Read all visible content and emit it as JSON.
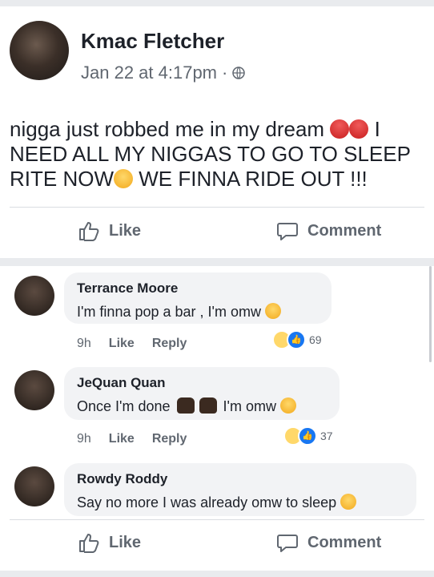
{
  "post": {
    "author": "Kmac Fletcher",
    "timestamp": "Jan 22 at 4:17pm",
    "separator": "·",
    "body_line1": "nigga just robbed me in my dream",
    "body_line1_end": "I",
    "body_line2": "NEED ALL MY NIGGAS TO GO TO SLEEP",
    "body_line3a": "RITE NOW",
    "body_line3b": "WE FINNA RIDE OUT !!!",
    "like_label": "Like",
    "comment_label": "Comment"
  },
  "comments": [
    {
      "name": "Terrance Moore",
      "text": "I'm finna pop a bar , I'm omw",
      "time": "9h",
      "like": "Like",
      "reply": "Reply",
      "reactions": "69"
    },
    {
      "name": "JeQuan Quan",
      "text_a": "Once I'm done",
      "text_b": "I'm omw",
      "time": "9h",
      "like": "Like",
      "reply": "Reply",
      "reactions": "37"
    },
    {
      "name": "Rowdy Roddy",
      "text": "Say no more I was already omw to sleep"
    }
  ],
  "footer": {
    "like_label": "Like",
    "comment_label": "Comment"
  },
  "icons": {
    "privacy": "globe-icon",
    "like": "thumbs-up-icon",
    "comment": "speech-bubble-icon"
  },
  "colors": {
    "text": "#1d2129",
    "muted": "#606770",
    "background": "#e9ebee",
    "like_blue": "#1877f2"
  }
}
